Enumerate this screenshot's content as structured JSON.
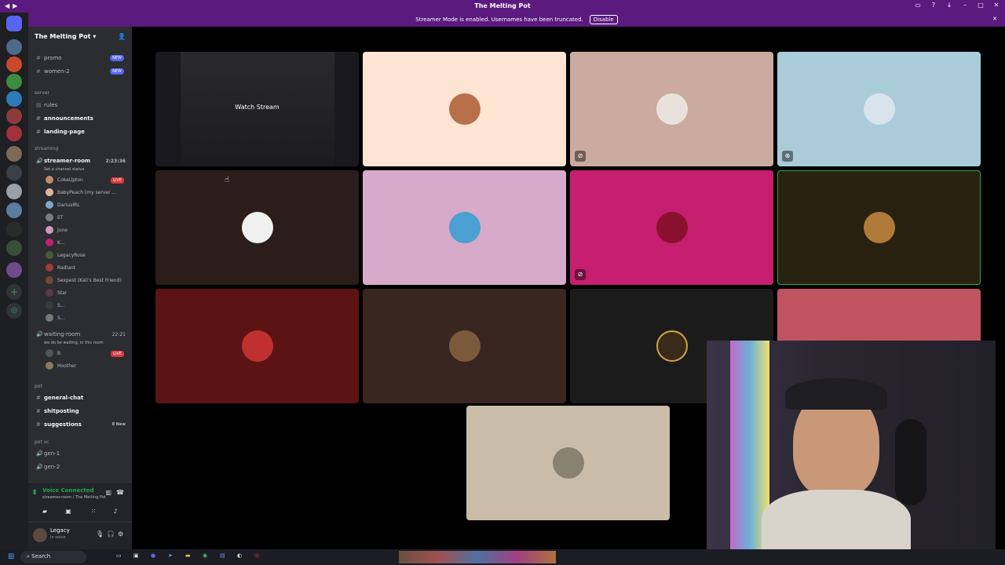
{
  "window": {
    "title": "The Melting Pot"
  },
  "banner": {
    "text": "Streamer Mode is enabled. Usernames have been truncated.",
    "button": "Disable"
  },
  "server": {
    "name": "The Melting Pot"
  },
  "channels": {
    "promo": "promo",
    "women2": "women-2",
    "new_badge": "NEW",
    "server_cat": "server",
    "rules": "rules",
    "announcements": "announcements",
    "landing": "landing-page",
    "streaming_cat": "streaming",
    "streamer_room": "streamer-room",
    "streamer_time": "2:23:36",
    "streamer_status": "Set a channel status",
    "waiting_room": "waiting-room",
    "waiting_time": "22:21",
    "waiting_status": "we do be waiting, in this room",
    "pot_cat": "pot",
    "general": "general-chat",
    "shitposting": "shitposting",
    "suggestions": "suggestions",
    "suggestions_badge": "8 New",
    "potvc_cat": "pot vc",
    "gen1": "gen-1",
    "gen2": "gen-2",
    "live": "LIVE"
  },
  "voice_users": [
    "CokeUpton",
    "BabyPeach (my server ...",
    "DariusIRL",
    "ET",
    "June",
    "K...",
    "LegacyRose",
    "Radiant",
    "Sexpest (Kali's Best Friend)",
    "Star",
    "S...",
    "S..."
  ],
  "waiting_users": [
    "B",
    "Hoother"
  ],
  "voice": {
    "status": "Voice Connected",
    "location": "streamer-room / The Melting Pot"
  },
  "user": {
    "name": "Legacy",
    "status": "In voice"
  },
  "stage": {
    "watch_label": "Watch Stream"
  },
  "taskbar": {
    "search": "Search"
  },
  "colors": {
    "brand": "#5b1a7e",
    "tile_colors": [
      "#1a1a1e",
      "#fde4d3",
      "#cbab9f",
      "#a9ccd8",
      "#2a1d1a",
      "#d7aac9",
      "#c61f6f",
      "#2a2210",
      "#5b1413",
      "#3a2620",
      "#1b1b1b",
      "#bf5460",
      "#c9bda9"
    ]
  }
}
